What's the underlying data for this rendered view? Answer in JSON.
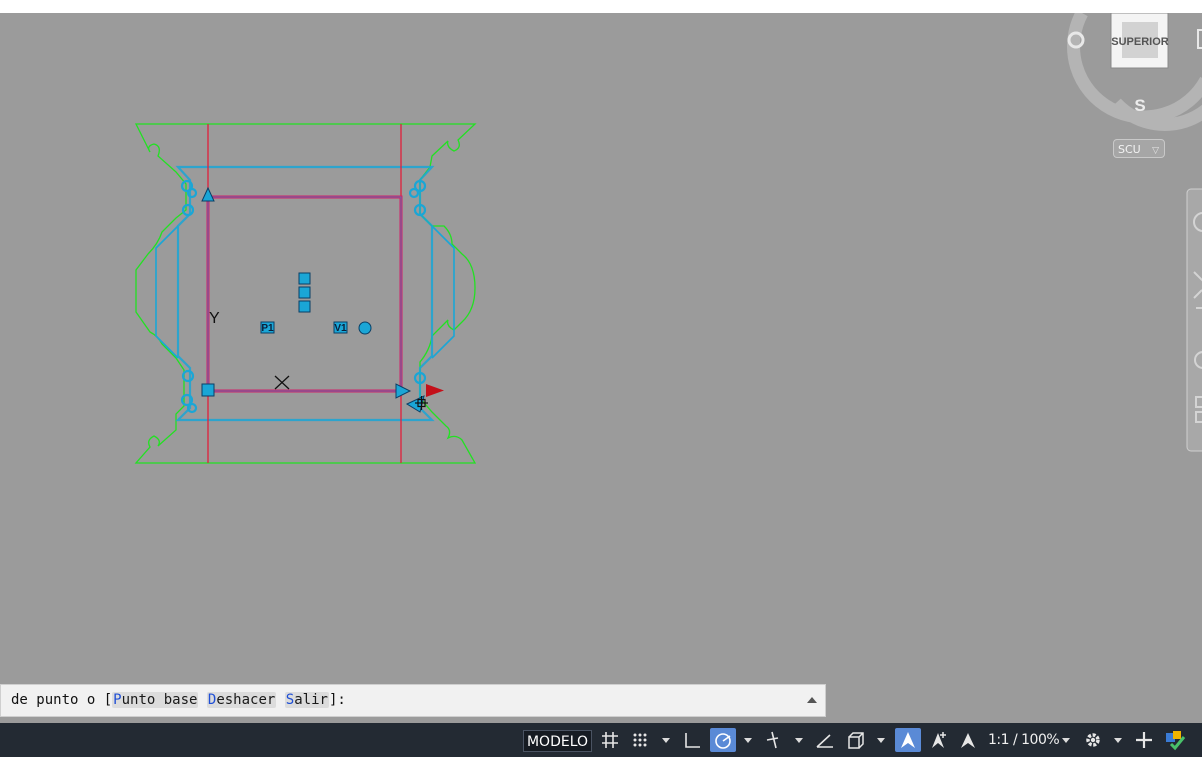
{
  "viewcube": {
    "face_label": "SUPERIOR",
    "compass_south": "S"
  },
  "scu_menu": {
    "label": "SCU"
  },
  "drawing": {
    "point_labels": {
      "p1": "P1",
      "v1": "V1"
    },
    "axis_labels": {
      "y": "Y"
    }
  },
  "command_line": {
    "prefix": "de punto o [",
    "options": [
      {
        "key": "P",
        "rest": "unto base"
      },
      {
        "key": "D",
        "rest": "eshacer"
      },
      {
        "key": "S",
        "rest": "alir"
      }
    ],
    "suffix": "]:"
  },
  "status_bar": {
    "model_label": "MODELO",
    "scale_label": "1:1 / 100%"
  },
  "colors": {
    "viewport_bg": "#9b9b9b",
    "outline_green": "#22e122",
    "fold_red": "#e0203a",
    "highlight_cyan": "#1aa6d6",
    "statusbar_bg": "#232a33"
  }
}
